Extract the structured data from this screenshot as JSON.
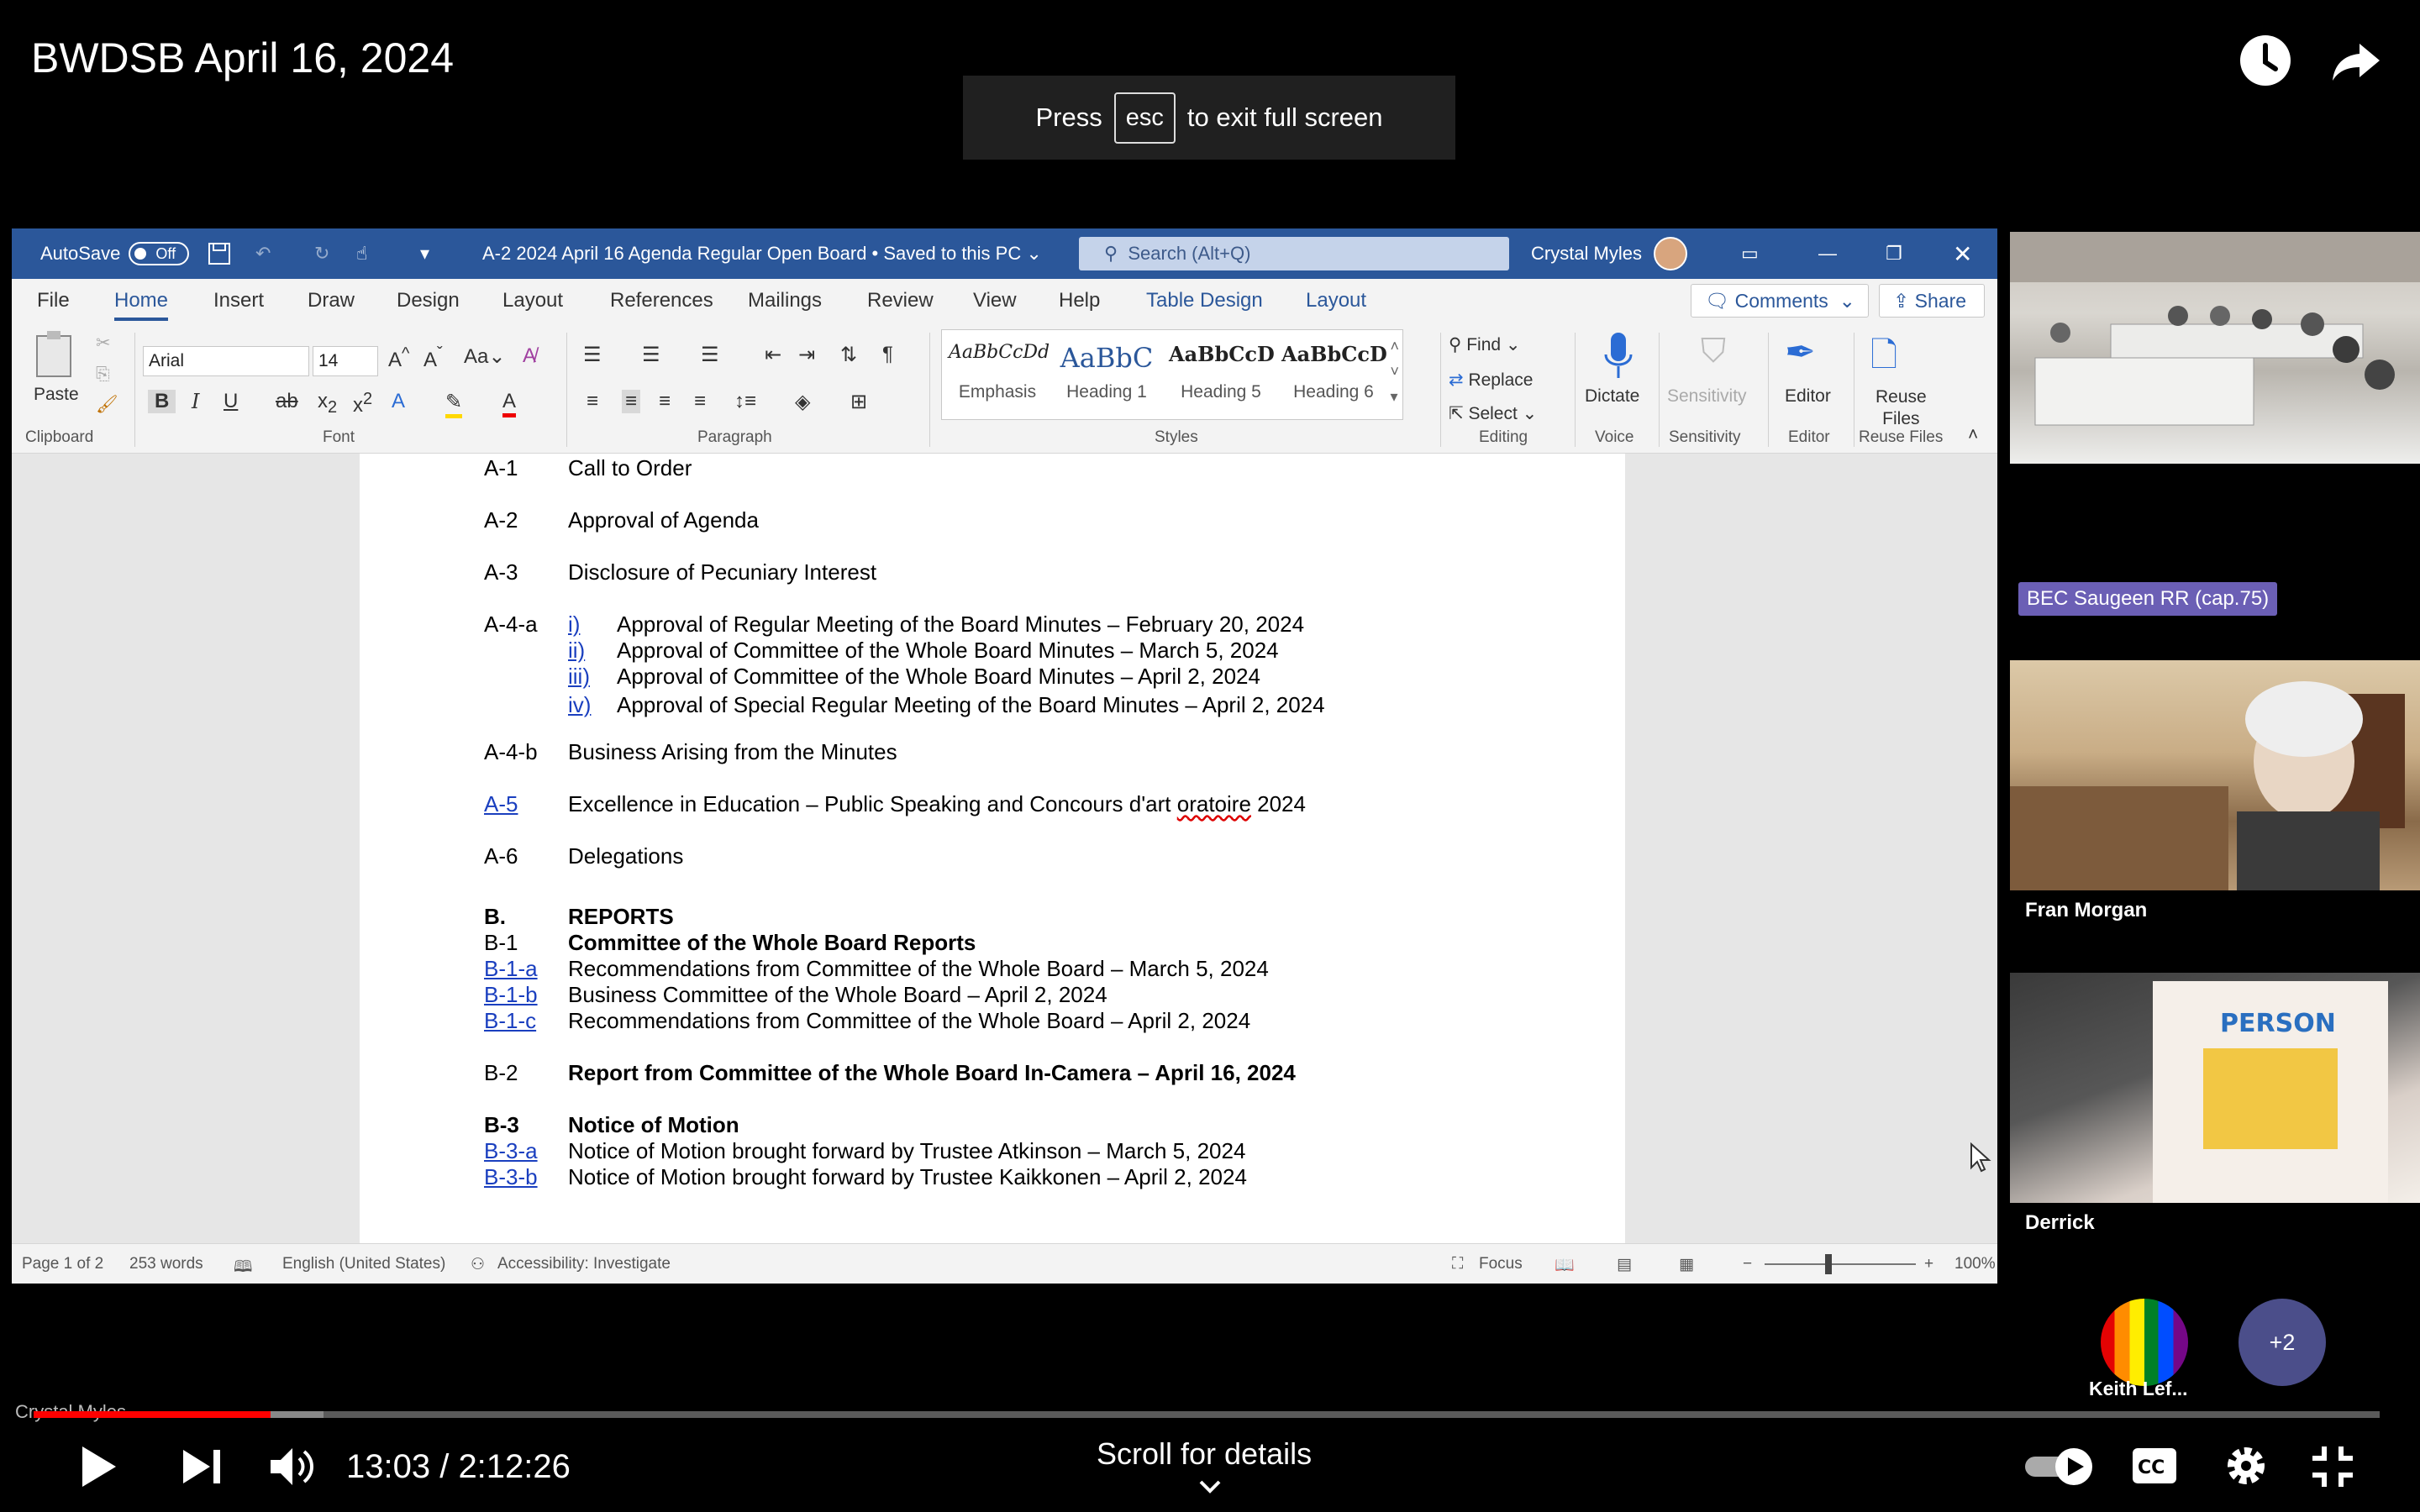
{
  "player": {
    "title": "BWDSB April 16, 2024",
    "esc_prefix": "Press",
    "esc_key": "esc",
    "esc_suffix": "to exit full screen",
    "current_time": "13:03 / 2:12:26",
    "scroll_hint": "Scroll for details",
    "progress_fraction": 0.101,
    "overlay_name": "Crystal Myles"
  },
  "word": {
    "autosave_label": "AutoSave",
    "autosave_state": "Off",
    "doc_title": "A-2 2024 April 16 Agenda Regular Open Board • Saved to this PC",
    "search_placeholder": "Search (Alt+Q)",
    "user_name": "Crystal Myles",
    "tabs": [
      "File",
      "Home",
      "Insert",
      "Draw",
      "Design",
      "Layout",
      "References",
      "Mailings",
      "Review",
      "View",
      "Help",
      "Table Design",
      "Layout"
    ],
    "comments_label": "Comments",
    "share_label": "Share",
    "ribbon": {
      "paste": "Paste",
      "clipboard": "Clipboard",
      "font_name": "Arial",
      "font_size": "14",
      "font": "Font",
      "paragraph": "Paragraph",
      "styles": "Styles",
      "style_items": [
        {
          "sample": "AaBbCcDd",
          "name": "Emphasis"
        },
        {
          "sample": "AaBbC",
          "name": "Heading 1"
        },
        {
          "sample": "AaBbCcD",
          "name": "Heading 5"
        },
        {
          "sample": "AaBbCcD",
          "name": "Heading 6"
        }
      ],
      "find": "Find",
      "replace": "Replace",
      "select": "Select",
      "editing": "Editing",
      "dictate": "Dictate",
      "voice": "Voice",
      "sensitivity_btn": "Sensitivity",
      "sensitivity": "Sensitivity",
      "editor_btn": "Editor",
      "editor": "Editor",
      "reuse_files_btn_1": "Reuse",
      "reuse_files_btn_2": "Files",
      "reuse_files": "Reuse Files"
    },
    "document": {
      "a1": {
        "code": "A-1",
        "text": "Call to Order"
      },
      "a2": {
        "code": "A-2",
        "text": "Approval of Agenda"
      },
      "a3": {
        "code": "A-3",
        "text": "Disclosure of Pecuniary Interest"
      },
      "a4a_code": "A-4-a",
      "a4a_items": [
        {
          "num": "i)",
          "text": "Approval of Regular Meeting of the Board Minutes – February 20, 2024"
        },
        {
          "num": "ii)",
          "text": "Approval of Committee of the Whole Board Minutes – March 5, 2024"
        },
        {
          "num": "iii)",
          "text": "Approval of Committee of the Whole Board Minutes – April 2, 2024"
        },
        {
          "num": "iv)",
          "text": "Approval of Special Regular Meeting of the Board Minutes – April 2, 2024"
        }
      ],
      "a4b": {
        "code": "A-4-b",
        "text": "Business Arising from the Minutes"
      },
      "a5": {
        "code": "A-5",
        "text_before": "Excellence in Education – Public Speaking and Concours d'art ",
        "text_squiggle": "oratoire",
        "text_after": " 2024"
      },
      "a6": {
        "code": "A-6",
        "text": "Delegations"
      },
      "b": {
        "code": "B.",
        "text": "REPORTS"
      },
      "b1": {
        "code": "B-1",
        "text": "Committee of the Whole Board Reports"
      },
      "b1_items": [
        {
          "code": "B-1-a",
          "text": "Recommendations from Committee of the Whole Board – March 5, 2024"
        },
        {
          "code": "B-1-b",
          "text": "Business Committee of the Whole Board – April 2, 2024"
        },
        {
          "code": "B-1-c",
          "text": "Recommendations from Committee of the Whole Board – April 2, 2024"
        }
      ],
      "b2": {
        "code": "B-2",
        "text": "Report from Committee of the Whole Board In-Camera – April 16, 2024"
      },
      "b3": {
        "code": "B-3",
        "text": "Notice of Motion"
      },
      "b3_items": [
        {
          "code": "B-3-a",
          "text": "Notice of Motion brought forward by Trustee Atkinson – March 5, 2024"
        },
        {
          "code": "B-3-b",
          "text": "Notice of Motion brought forward by Trustee Kaikkonen – April 2, 2024"
        }
      ]
    },
    "status": {
      "page": "Page 1 of 2",
      "words": "253 words",
      "language": "English (United States)",
      "accessibility": "Accessibility: Investigate",
      "focus": "Focus",
      "zoom": "100%"
    }
  },
  "participants": {
    "room_label": "BEC Saugeen RR (cap.75)",
    "fran": "Fran Morgan",
    "derrick": "Derrick",
    "keith": "Keith Lef...",
    "more": "+2"
  }
}
